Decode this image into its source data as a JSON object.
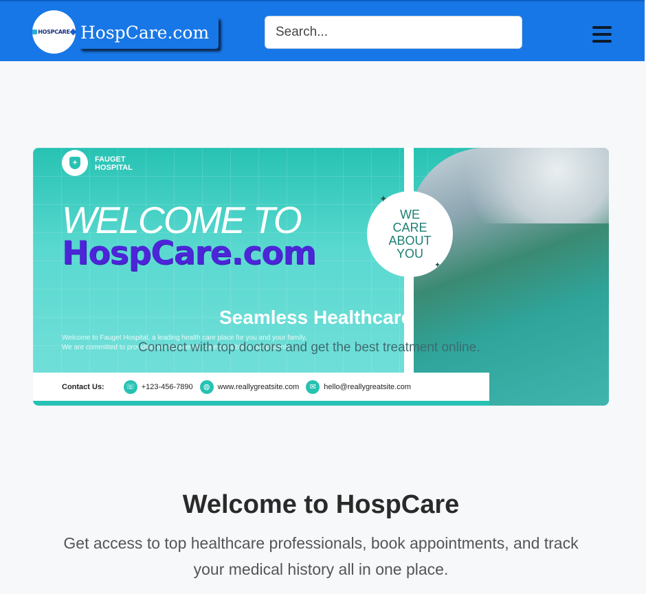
{
  "navbar": {
    "logo_text": "HOSPCARE",
    "brand": "HospCare.com",
    "search_placeholder": "Search...",
    "menu_icon": "hamburger-menu-icon"
  },
  "banner": {
    "hospital_name_line1": "FAUGET",
    "hospital_name_line2": "HOSPITAL",
    "headline": "WELCOME TO",
    "site_name": "HospCare.com",
    "small_line1": "Welcome to Fauget Hospital, a leading health care place for you and your family.",
    "small_line2": "We are committed to providing the best health care possible to our patients.",
    "seamless": "Seamless Healthcare",
    "connect": "Connect with top doctors and get the best treatment online.",
    "care_line1": "WE",
    "care_line2": "CARE",
    "care_line3": "ABOUT",
    "care_line4": "YOU",
    "contact_label": "Contact Us:",
    "phone": "+123-456-7890",
    "website": "www.reallygreatsite.com",
    "email": "hello@reallygreatsite.com"
  },
  "welcome": {
    "title": "Welcome to HospCare",
    "text": "Get access to top healthcare professionals, book appointments, and track your medical history all in one place."
  },
  "colors": {
    "navbar": "#1877e6",
    "accent": "#27c2b3",
    "site_name": "#4c25d8"
  }
}
